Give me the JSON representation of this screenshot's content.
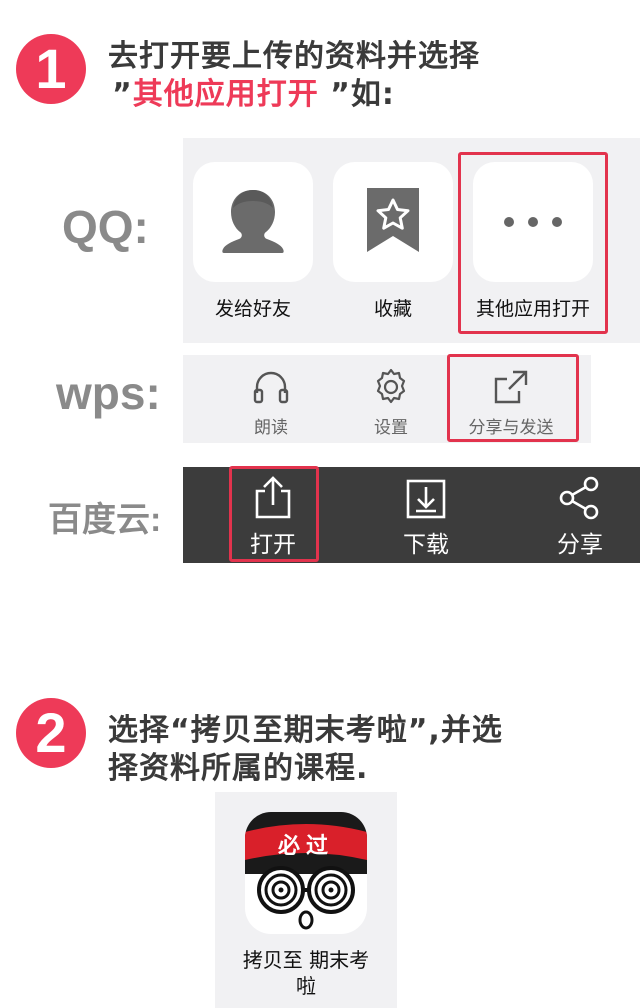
{
  "step1": {
    "number": "1",
    "line1": "去打开要上传的资料并选择",
    "line2_open_quote": "”",
    "line2_highlight": "其他应用打开",
    "line2_close": " ”如:"
  },
  "qq": {
    "label": "QQ:",
    "items": [
      {
        "label": "发给好友",
        "icon": "person-icon"
      },
      {
        "label": "收藏",
        "icon": "bookmark-star-icon"
      },
      {
        "label": "其他应用打开",
        "icon": "more-dots-icon"
      }
    ]
  },
  "wps": {
    "label": "wps:",
    "items": [
      {
        "label": "朗读",
        "icon": "headphones-icon"
      },
      {
        "label": "设置",
        "icon": "gear-icon"
      },
      {
        "label": "分享与发送",
        "icon": "share-out-icon"
      }
    ]
  },
  "baidu": {
    "label": "百度云:",
    "items": [
      {
        "label": "打开",
        "icon": "upload-open-icon"
      },
      {
        "label": "下载",
        "icon": "download-icon"
      },
      {
        "label": "分享",
        "icon": "share-nodes-icon"
      }
    ]
  },
  "step2": {
    "number": "2",
    "line1": "选择“拷贝至期末考啦”,并选",
    "line2": "择资料所属的课程."
  },
  "app": {
    "name_line1": "拷贝至 期末考",
    "name_line2": "啦",
    "badge_text": "必过",
    "icon": "app-logo-icon"
  },
  "colors": {
    "accent": "#ee3a58",
    "highlight_box": "#e2334d",
    "panel_bg": "#f1f1f3",
    "dark_bar": "#3c3c3c"
  }
}
